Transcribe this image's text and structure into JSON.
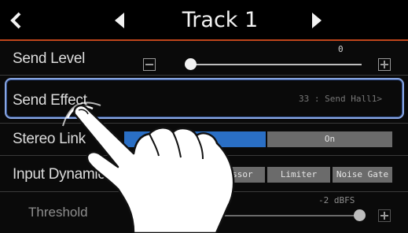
{
  "header": {
    "title": "Track 1",
    "back_icon": "chevron-left-icon",
    "prev_icon": "triangle-left-icon",
    "next_icon": "triangle-right-icon",
    "accent_color": "#c0461b"
  },
  "send_level": {
    "label": "Send Level",
    "value": "0",
    "level": 0
  },
  "send_effect": {
    "label": "Send Effect",
    "value": "33 : Send Hall1>",
    "highlight_color": "#8aa7e3"
  },
  "stereo_link": {
    "label": "Stereo Link",
    "options": [
      "Off",
      "On"
    ],
    "selected": "Off",
    "selected_color": "#2a6fc5"
  },
  "input_dynamics": {
    "label": "Input Dynamics",
    "options": [
      "Compressor",
      "Limiter",
      "Noise Gate"
    ]
  },
  "threshold": {
    "label": "Threshold",
    "value": "-2 dBFS"
  },
  "gesture": {
    "icon": "tap-hand-icon"
  }
}
